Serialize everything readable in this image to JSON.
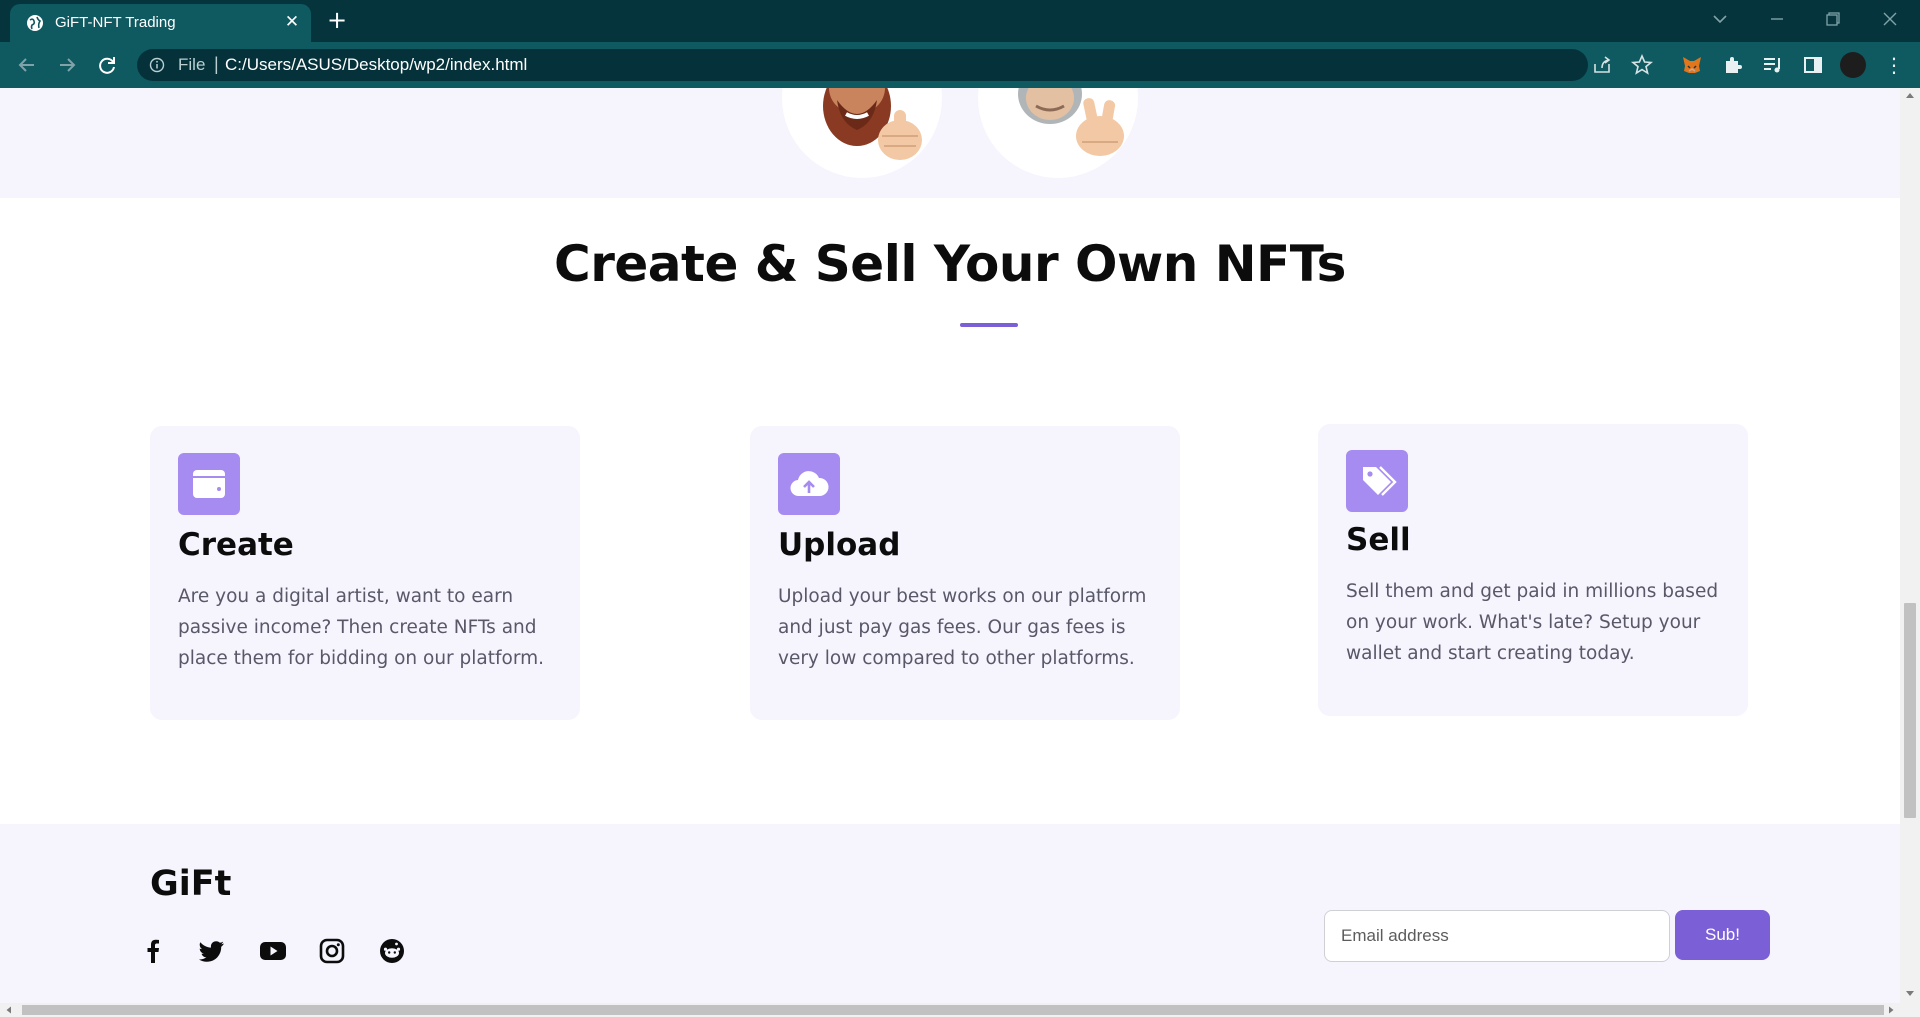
{
  "browser": {
    "tab_title": "GiFT-NFT Trading",
    "omnibox_scheme": "File",
    "omnibox_separator": "|",
    "url": "C:/Users/ASUS/Desktop/wp2/index.html",
    "new_tab_symbol": "+",
    "close_symbol": "✕",
    "menu_symbol": "⋮"
  },
  "section": {
    "title": "Create & Sell Your Own NFTs",
    "accent": "#7b5fd6"
  },
  "cards": [
    {
      "icon": "wallet-icon",
      "title": "Create",
      "text": "Are you a digital artist, want to earn passive income? Then create NFTs and place them for bidding on our platform."
    },
    {
      "icon": "cloud-upload-icon",
      "title": "Upload",
      "text": "Upload your best works on our platform and just pay gas fees. Our gas fees is very low compared to other platforms."
    },
    {
      "icon": "tags-icon",
      "title": "Sell",
      "text": "Sell them and get paid in millions based on your work. What's late? Setup your wallet and start creating today."
    }
  ],
  "footer": {
    "logo": "GiFt",
    "social": [
      "facebook-icon",
      "twitter-icon",
      "youtube-icon",
      "instagram-icon",
      "reddit-icon"
    ],
    "email_placeholder": "Email address",
    "submit_label": "Sub!"
  },
  "colors": {
    "titlebar": "#06343d",
    "toolbar": "#0f5960",
    "card_bg": "#f6f4fd",
    "icon_bg": "#a68bf0",
    "button": "#7b5fd6"
  }
}
